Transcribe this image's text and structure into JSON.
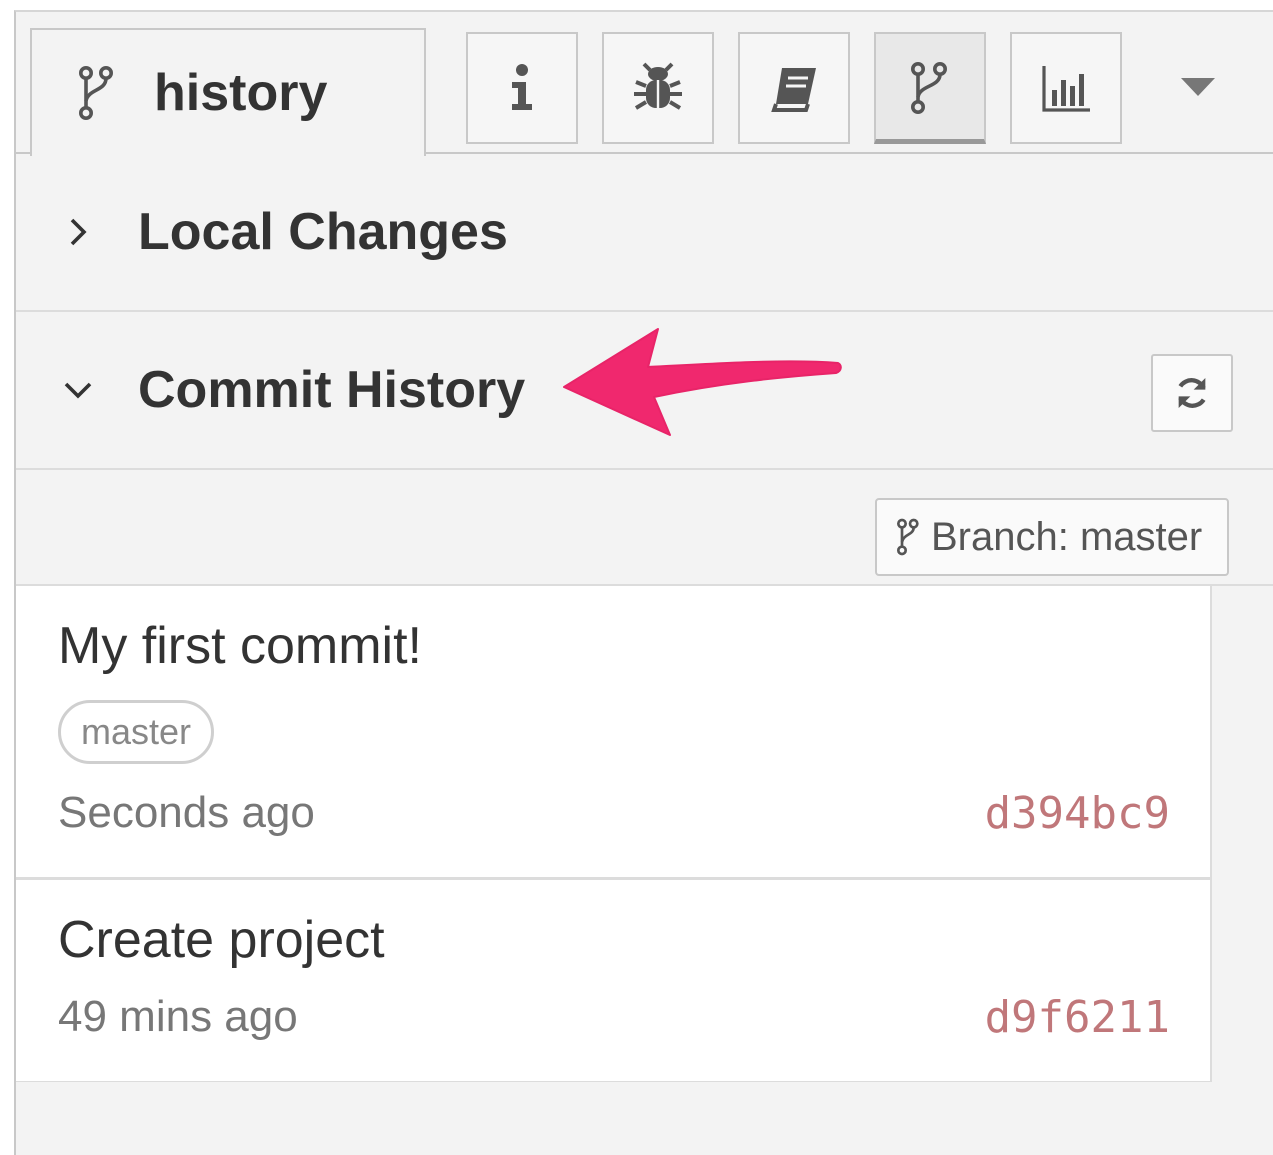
{
  "tabs": {
    "active_label": "history",
    "menu_caret": "chevron-down-icon",
    "tools": [
      {
        "name": "info",
        "icon": "info-icon"
      },
      {
        "name": "debug",
        "icon": "bug-icon"
      },
      {
        "name": "help",
        "icon": "book-icon"
      },
      {
        "name": "history",
        "icon": "git-branch-icon",
        "selected": true
      },
      {
        "name": "dashboard",
        "icon": "bar-chart-icon"
      }
    ]
  },
  "sections": {
    "local_changes": {
      "title": "Local Changes",
      "expanded": false
    },
    "commit_history": {
      "title": "Commit History",
      "expanded": true
    }
  },
  "branch_button": {
    "label": "Branch: master"
  },
  "commits": [
    {
      "message": "My first commit!",
      "tag": "master",
      "time": "Seconds ago",
      "sha": "d394bc9"
    },
    {
      "message": "Create project",
      "time": "49 mins ago",
      "sha": "d9f6211"
    }
  ],
  "colors": {
    "sha": "#c0777a",
    "annotation_arrow": "#f0286e",
    "panel_bg": "#f3f3f3"
  }
}
